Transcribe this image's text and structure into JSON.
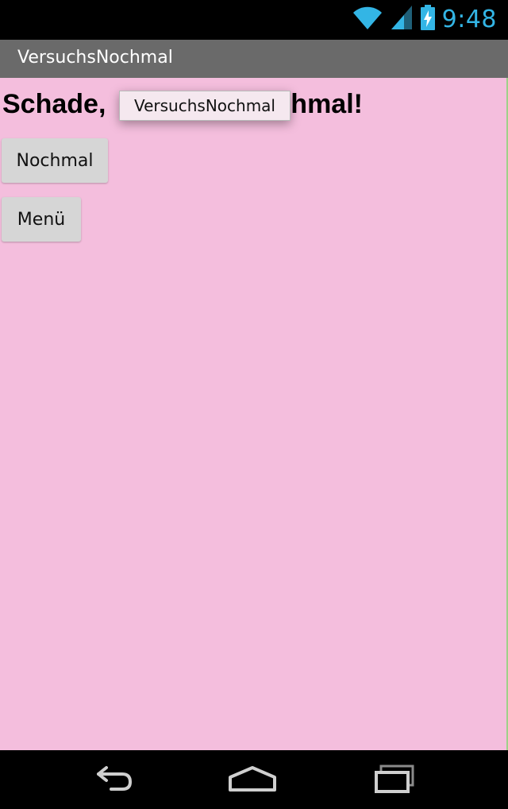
{
  "status_bar": {
    "time": "9:48",
    "icons": [
      "wifi-icon",
      "signal-icon",
      "battery-icon"
    ],
    "accent_color": "#33b5e5"
  },
  "app_bar": {
    "title": "VersuchsNochmal",
    "background": "#6a6a6a"
  },
  "main": {
    "background": "#f4bedd",
    "headline_visible_left": "Schade,",
    "headline_visible_right": "chmal!",
    "buttons": [
      {
        "label": "Nochmal"
      },
      {
        "label": "Menü"
      }
    ]
  },
  "toast": {
    "text": "VersuchsNochmal"
  },
  "nav_bar": {
    "icons": [
      "back-icon",
      "home-icon",
      "recent-apps-icon"
    ]
  }
}
